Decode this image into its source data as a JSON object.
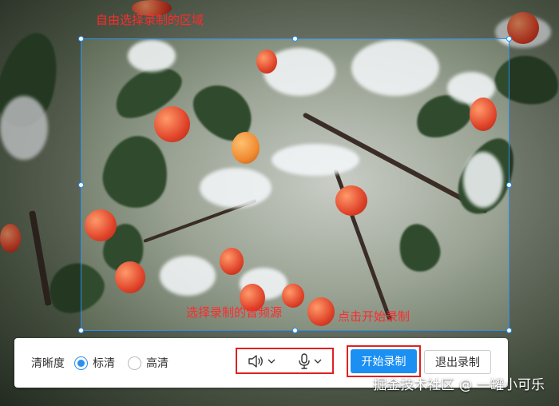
{
  "annotations": {
    "select_region": "自由选择录制的区域",
    "select_device": "选择录制的音频源",
    "click_start": "点击开始录制"
  },
  "toolbar": {
    "quality_label": "清晰度",
    "quality_options": [
      {
        "label": "标清",
        "checked": true
      },
      {
        "label": "高清",
        "checked": false
      }
    ],
    "speaker_icon": "speaker-icon",
    "mic_icon": "microphone-icon",
    "start_label": "开始录制",
    "exit_label": "退出录制"
  },
  "watermark": "掘金技术社区 @ 一罐小可乐",
  "colors": {
    "accent": "#1b8ff2",
    "annotation": "#ff2b2b",
    "selection_border": "#2b8ff0"
  }
}
